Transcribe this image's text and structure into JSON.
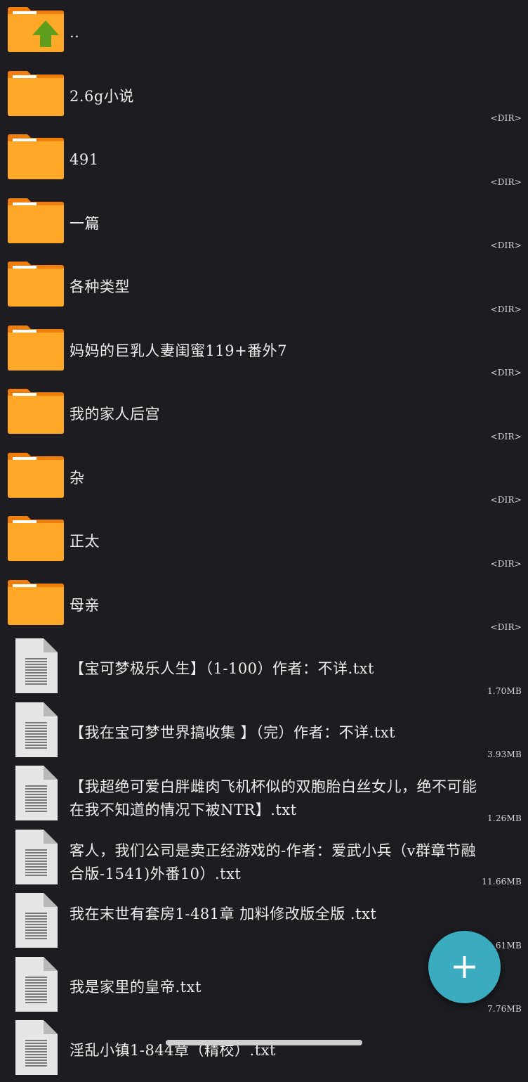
{
  "colors": {
    "background": "#1c1c21",
    "folder": "#ffa726",
    "folder_tab": "#ef7e0c",
    "up_arrow": "#5f9d1c",
    "file_page": "#e6e6e6",
    "fab": "#3bacbf"
  },
  "entries": [
    {
      "type": "up",
      "name": "..",
      "meta": ""
    },
    {
      "type": "dir",
      "name": "2.6g小说",
      "meta": "<DIR>"
    },
    {
      "type": "dir",
      "name": "491",
      "meta": "<DIR>"
    },
    {
      "type": "dir",
      "name": "一篇",
      "meta": "<DIR>"
    },
    {
      "type": "dir",
      "name": "各种类型",
      "meta": "<DIR>"
    },
    {
      "type": "dir",
      "name": "妈妈的巨乳人妻闺蜜119+番外7",
      "meta": "<DIR>"
    },
    {
      "type": "dir",
      "name": "我的家人后宫",
      "meta": "<DIR>"
    },
    {
      "type": "dir",
      "name": "杂",
      "meta": "<DIR>"
    },
    {
      "type": "dir",
      "name": "正太",
      "meta": "<DIR>"
    },
    {
      "type": "dir",
      "name": "母亲",
      "meta": "<DIR>"
    },
    {
      "type": "file",
      "name": "【宝可梦极乐人生】（1-100）作者：不详.txt",
      "meta": "1.70MB"
    },
    {
      "type": "file",
      "name": "【我在宝可梦世界搞收集 】（完）作者：不详.txt",
      "meta": "3.93MB"
    },
    {
      "type": "file",
      "name": "【我超绝可爱白胖雌肉飞机杯似的双胞胎白丝女儿，绝不可能在我不知道的情况下被NTR】.txt",
      "meta": "1.26MB"
    },
    {
      "type": "file",
      "name": "客人，我们公司是卖正经游戏的-作者：爱武小兵（v群章节融合版-1541)外番10）.txt",
      "meta": "11.66MB"
    },
    {
      "type": "file",
      "name": "我在末世有套房1-481章  加料修改版全版 .txt",
      "meta": "2.61MB"
    },
    {
      "type": "file",
      "name": "我是家里的皇帝.txt",
      "meta": "7.76MB"
    },
    {
      "type": "file",
      "name": "淫乱小镇1-844章（精校）.txt",
      "meta": ""
    }
  ],
  "fab": {
    "icon": "plus-icon"
  },
  "icons": {
    "up": "folder-up-icon",
    "dir": "folder-icon",
    "file": "text-file-icon"
  }
}
